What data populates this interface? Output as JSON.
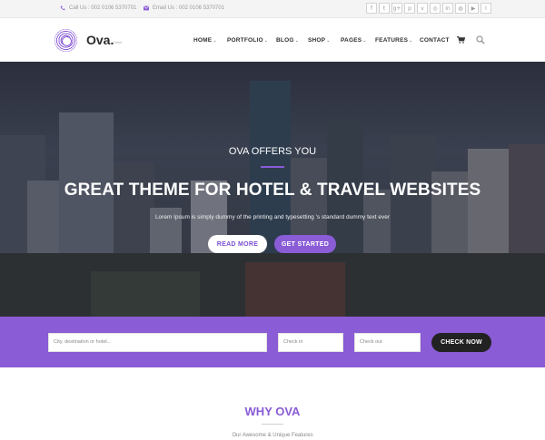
{
  "topbar": {
    "call": "Call Us : 002 0106 5370701",
    "email": "Email Us : 002 0106 5370701",
    "social": [
      {
        "name": "facebook",
        "glyph": "f"
      },
      {
        "name": "twitter",
        "glyph": "t"
      },
      {
        "name": "google-plus",
        "glyph": "g+"
      },
      {
        "name": "pinterest",
        "glyph": "p"
      },
      {
        "name": "vimeo",
        "glyph": "v"
      },
      {
        "name": "instagram",
        "glyph": "◎"
      },
      {
        "name": "linkedin",
        "glyph": "in"
      },
      {
        "name": "dribbble",
        "glyph": "◍"
      },
      {
        "name": "youtube",
        "glyph": "▶"
      },
      {
        "name": "rss",
        "glyph": "⌇"
      }
    ]
  },
  "header": {
    "logo": "Ova.",
    "logo_sub": "Hotel",
    "nav": [
      "HOME",
      "PORTFOLIO",
      "BLOG",
      "SHOP",
      "PAGES",
      "FEATURES",
      "CONTACT"
    ]
  },
  "hero": {
    "kicker": "OVA OFFERS YOU",
    "headline": "GREAT THEME FOR HOTEL & TRAVEL WEBSITES",
    "lede": "Lorem Ipsum is simply dummy of the printing and typesetting 's standard dummy text ever",
    "read_more": "READ MORE",
    "get_started": "GET STARTED"
  },
  "booking": {
    "destination_placeholder": "City, destination or hotel...",
    "check_in_placeholder": "Check in",
    "check_out_placeholder": "Check out",
    "check_now": "CHECK NOW"
  },
  "why": {
    "title": "WHY OVA",
    "subtitle": "Our Awesome & Unique Features"
  },
  "colors": {
    "accent": "#8a5cd6",
    "dark_button": "#222222",
    "topbar_bg": "#f4f4f4"
  }
}
